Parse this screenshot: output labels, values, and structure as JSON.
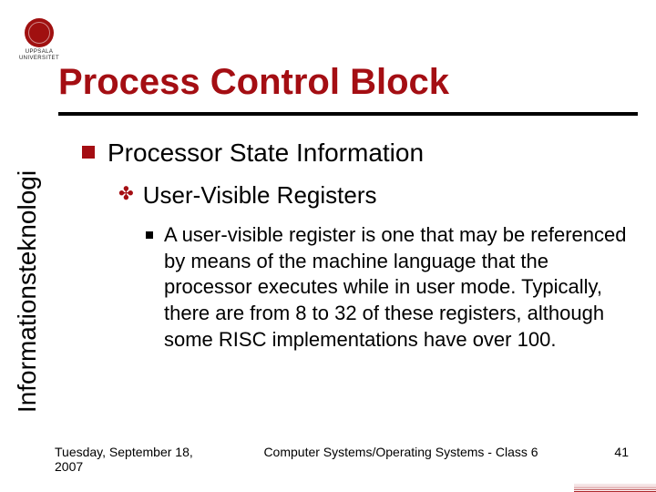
{
  "logo": {
    "line1": "UPPSALA",
    "line2": "UNIVERSITET"
  },
  "title": "Process Control Block",
  "sidebar": "Informationsteknologi",
  "content": {
    "h1": "Processor State Information",
    "h2": "User-Visible Registers",
    "body": "A user-visible register is one that may be referenced by means of the machine language that the processor executes while in user mode. Typically, there are from 8 to 32 of these registers, although some RISC implementations have over 100."
  },
  "footer": {
    "date": "Tuesday, September 18, 2007",
    "course": "Computer Systems/Operating Systems - Class 6",
    "page": "41"
  }
}
